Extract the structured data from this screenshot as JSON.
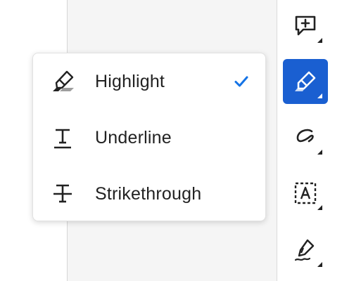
{
  "menu": {
    "items": [
      {
        "label": "Highlight",
        "icon": "highlight-icon",
        "selected": true
      },
      {
        "label": "Underline",
        "icon": "underline-icon",
        "selected": false
      },
      {
        "label": "Strikethrough",
        "icon": "strikethrough-icon",
        "selected": false
      }
    ]
  },
  "toolbar": {
    "tools": [
      {
        "icon": "add-comment-icon",
        "active": false
      },
      {
        "icon": "highlight-pen-icon",
        "active": true
      },
      {
        "icon": "freehand-draw-icon",
        "active": false
      },
      {
        "icon": "text-box-icon",
        "active": false
      },
      {
        "icon": "signature-pen-icon",
        "active": false
      }
    ]
  },
  "colors": {
    "accent": "#1a5fd1",
    "check": "#1473e6",
    "text": "#222222"
  }
}
